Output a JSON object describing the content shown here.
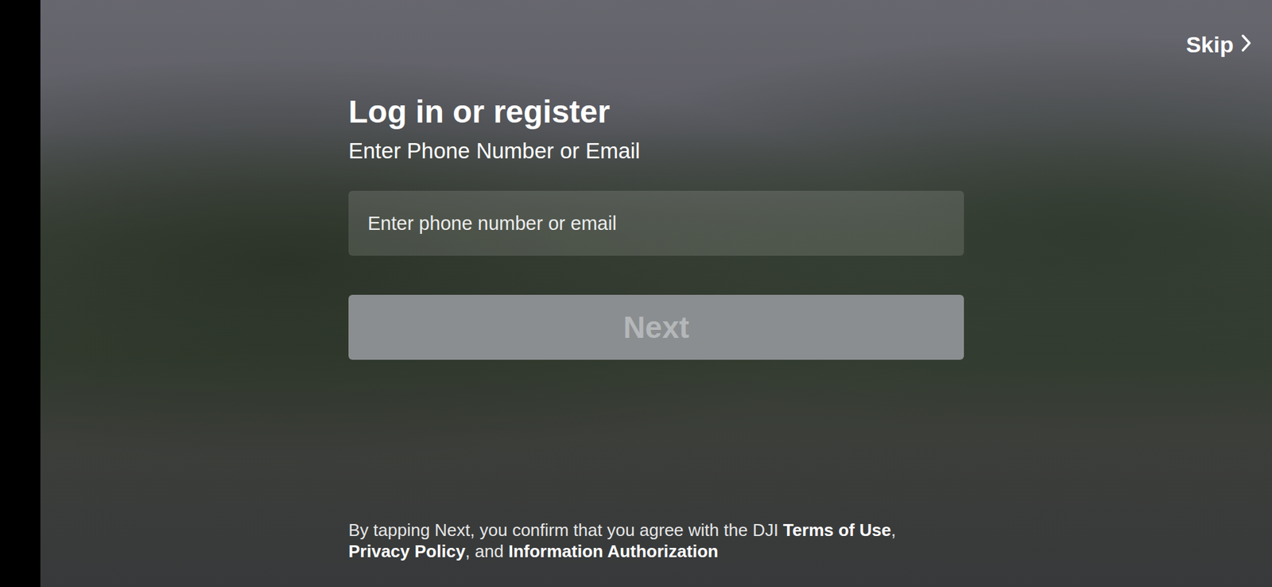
{
  "skip": {
    "label": "Skip"
  },
  "title": "Log in or register",
  "subtitle": "Enter Phone Number or Email",
  "input": {
    "placeholder": "Enter phone number or email"
  },
  "next": {
    "label": "Next",
    "disabled": true
  },
  "footer": {
    "lines": [
      [
        {
          "text": "By tapping Next, you confirm that you agree with the DJI ",
          "kind": "plain"
        },
        {
          "text": "Terms of Use",
          "kind": "link"
        },
        {
          "text": ",",
          "kind": "plain"
        }
      ],
      [
        {
          "text": "Privacy Policy",
          "kind": "link"
        },
        {
          "text": ", and ",
          "kind": "plain"
        },
        {
          "text": "Information Authorization",
          "kind": "link"
        }
      ]
    ]
  }
}
